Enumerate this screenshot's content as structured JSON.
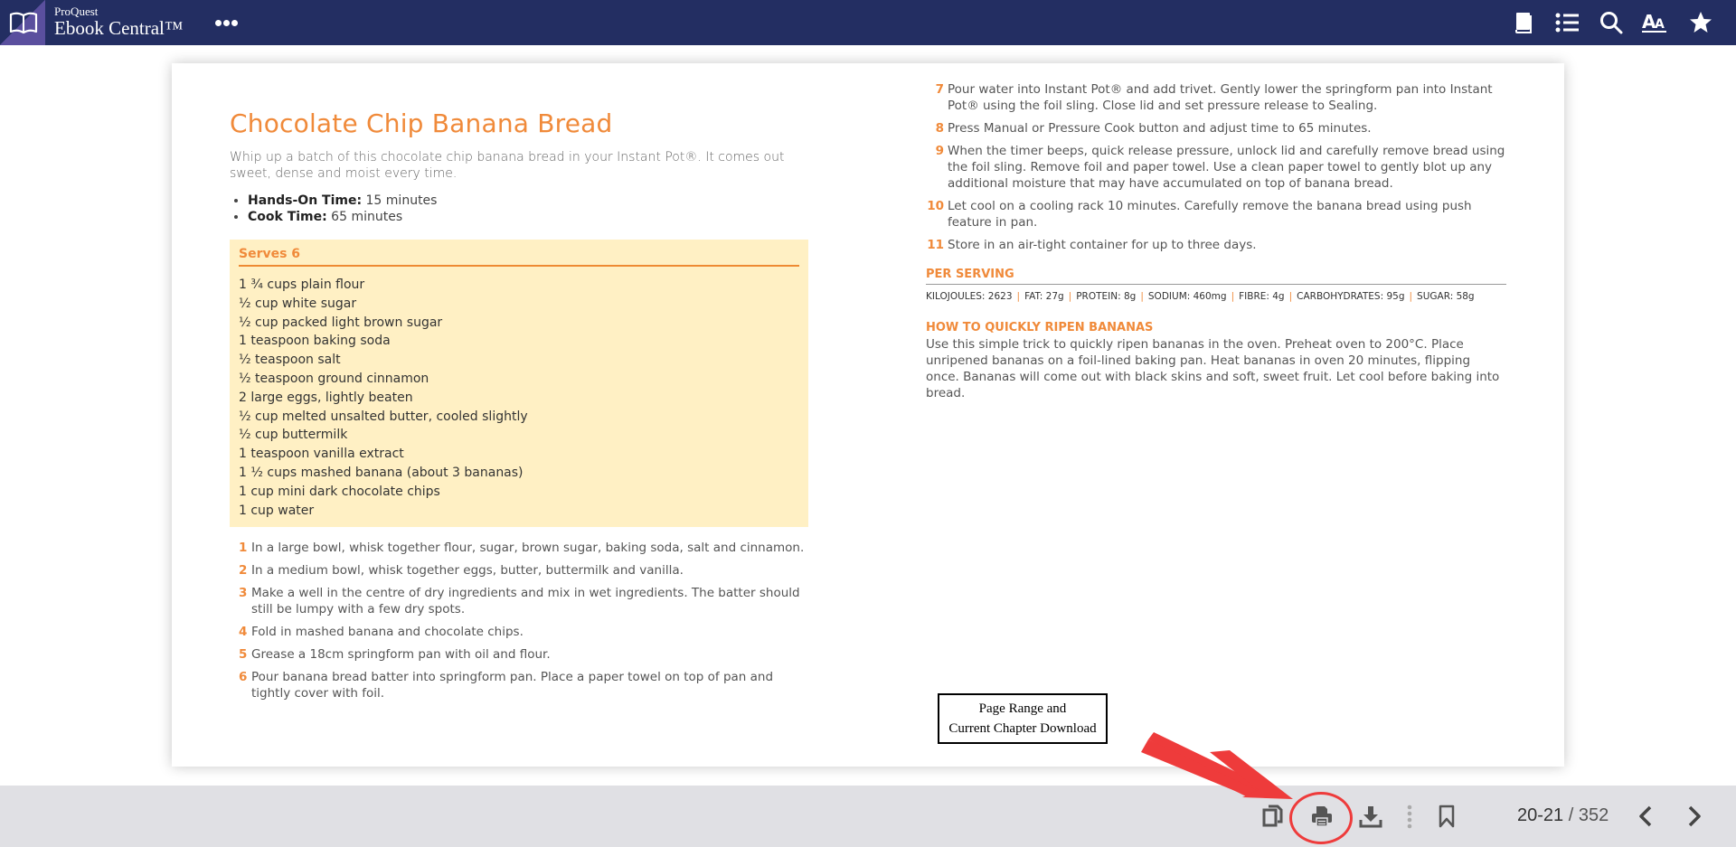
{
  "header": {
    "brand_small": "ProQuest",
    "brand_big": "Ebook Central™",
    "icons": [
      "book-icon",
      "list-icon",
      "search-icon",
      "text-size-icon",
      "star-icon"
    ]
  },
  "recipe": {
    "title": "Chocolate Chip Banana Bread",
    "intro": "Whip up a batch of this chocolate chip banana bread in your Instant Pot®. It comes out sweet, dense and moist every time.",
    "times": [
      {
        "label": "Hands-On Time:",
        "value": " 15 minutes"
      },
      {
        "label": "Cook Time:",
        "value": " 65 minutes"
      }
    ],
    "serves": "Serves 6",
    "ingredients": [
      "1 ¾ cups plain flour",
      "½ cup white sugar",
      "½ cup packed light brown sugar",
      "1 teaspoon baking soda",
      "½ teaspoon salt",
      "½ teaspoon ground cinnamon",
      "2 large eggs, lightly beaten",
      "½ cup melted unsalted butter, cooled slightly",
      "½ cup buttermilk",
      "1 teaspoon vanilla extract",
      "1 ½ cups mashed banana (about 3 bananas)",
      "1 cup mini dark chocolate chips",
      "1 cup water"
    ],
    "steps_left": [
      {
        "n": "1",
        "text": "In a large bowl, whisk together flour, sugar, brown sugar, baking soda, salt and cinnamon."
      },
      {
        "n": "2",
        "text": "In a medium bowl, whisk together eggs, butter, buttermilk and vanilla."
      },
      {
        "n": "3",
        "text": "Make a well in the centre of dry ingredients and mix in wet ingredients. The batter should still be lumpy with a few dry spots."
      },
      {
        "n": "4",
        "text": "Fold in mashed banana and chocolate chips."
      },
      {
        "n": "5",
        "text": "Grease a 18cm springform pan with oil and flour."
      },
      {
        "n": "6",
        "text": "Pour banana bread batter into springform pan. Place a paper towel on top of pan and tightly cover with foil."
      }
    ],
    "steps_right": [
      {
        "n": "7",
        "text": "Pour water into Instant Pot® and add trivet. Gently lower the springform pan into Instant Pot® using the foil sling. Close lid and set pressure release to Sealing."
      },
      {
        "n": "8",
        "text": "Press Manual or Pressure Cook button and adjust time to 65 minutes."
      },
      {
        "n": "9",
        "text": "When the timer beeps, quick release pressure, unlock lid and carefully remove bread using the foil sling. Remove foil and paper towel. Use a clean paper towel to gently blot up any additional moisture that may have accumulated on top of banana bread."
      },
      {
        "n": "10",
        "text": "Let cool on a cooling rack 10 minutes. Carefully remove the banana bread using push feature in pan."
      },
      {
        "n": "11",
        "text": "Store in an air-tight container for up to three days."
      }
    ],
    "per_serving": {
      "heading": "PER SERVING",
      "items": [
        "KILOJOULES: 2623",
        "FAT: 27g",
        "PROTEIN: 8g",
        "SODIUM: 460mg",
        "FIBRE: 4g",
        "CARBOHYDRATES: 95g",
        "SUGAR: 58g"
      ]
    },
    "ripen": {
      "heading": "HOW TO QUICKLY RIPEN BANANAS",
      "text": "Use this simple trick to quickly ripen bananas in the oven. Preheat oven to 200°C. Place unripened bananas on a foil-lined baking pan. Heat bananas in oven 20 minutes, flipping once. Bananas will come out with black skins and soft, sweet fruit. Let cool before baking into bread."
    }
  },
  "annotation": {
    "line1": "Page Range and",
    "line2": "Current Chapter Download",
    "arrow_color": "#ee3b3b"
  },
  "toolbar": {
    "icons": [
      "copy-icon",
      "print-icon",
      "download-icon",
      "more-vertical-icon",
      "bookmark-icon"
    ],
    "page_current": "20-21",
    "page_sep": " / ",
    "page_total": "352"
  },
  "colors": {
    "header_bg": "#232e62",
    "accent_orange": "#f08a3a",
    "serves_bg": "#fff0c4",
    "toolbar_bg": "#e0e0e4"
  }
}
